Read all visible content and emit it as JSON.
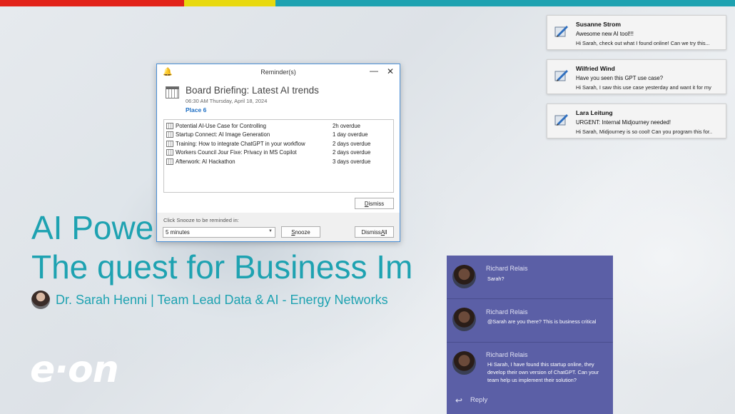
{
  "colors": {
    "bar": [
      "#e2231a",
      "#e8d90f",
      "#1ea2b1"
    ],
    "accent": "#1ea2b1",
    "chat_bg": "#5b5fa6"
  },
  "slide": {
    "title_line1": "AI Powe",
    "title_line2": "The quest for Business Im",
    "author": "Dr. Sarah Henni | Team Lead Data & AI - Energy Networks",
    "logo": "e·on"
  },
  "reminder": {
    "window_title": "Reminder(s)",
    "event_title": "Board Briefing: Latest AI trends",
    "event_time": "06:30 AM Thursday, April 18, 2024",
    "event_place": "Place 6",
    "items": [
      {
        "name": "Potential AI-Use Case for Controlling",
        "due": "2h overdue"
      },
      {
        "name": "Startup Connect: AI Image Generation",
        "due": "1 day overdue"
      },
      {
        "name": "Training: How to integrate ChatGPT in your workflow",
        "due": "2 days overdue"
      },
      {
        "name": "Workers Council Jour Fixe: Privacy in MS Copilot",
        "due": "2 days overdue"
      },
      {
        "name": "Afterwork: AI Hackathon",
        "due": "3 days overdue"
      }
    ],
    "dismiss_label": "Dismiss",
    "snooze_prompt": "Click Snooze to be reminded in:",
    "snooze_value": "5 minutes",
    "snooze_label": "Snooze",
    "dismiss_all_label": "Dismiss All"
  },
  "notifications": [
    {
      "sender": "Susanne Strom",
      "subject": "Awesome new AI tool!!!",
      "preview": "Hi Sarah, check out what I found online! Can we try this...",
      "icon": "mail-icon"
    },
    {
      "sender": "Wilfried Wind",
      "subject": "Have you seen this GPT use case?",
      "preview": "Hi Sarah, I saw this use case yesterday and want it for my",
      "icon": "mail-icon"
    },
    {
      "sender": "Lara Leitung",
      "subject": "URGENT: Internal Midjourney needed!",
      "preview": "Hi Sarah, Midjourney is so cool! Can you program this for..",
      "icon": "mail-icon"
    }
  ],
  "chat": {
    "messages": [
      {
        "sender": "Richard Relais",
        "text": "Sarah?"
      },
      {
        "sender": "Richard Relais",
        "text": "@Sarah are you there? This is business critical"
      },
      {
        "sender": "Richard Relais",
        "text": "Hi Sarah, I have found this startup online, they develop their own version of ChatGPT. Can your team help us implement their solution?"
      }
    ],
    "reply_label": "Reply"
  }
}
